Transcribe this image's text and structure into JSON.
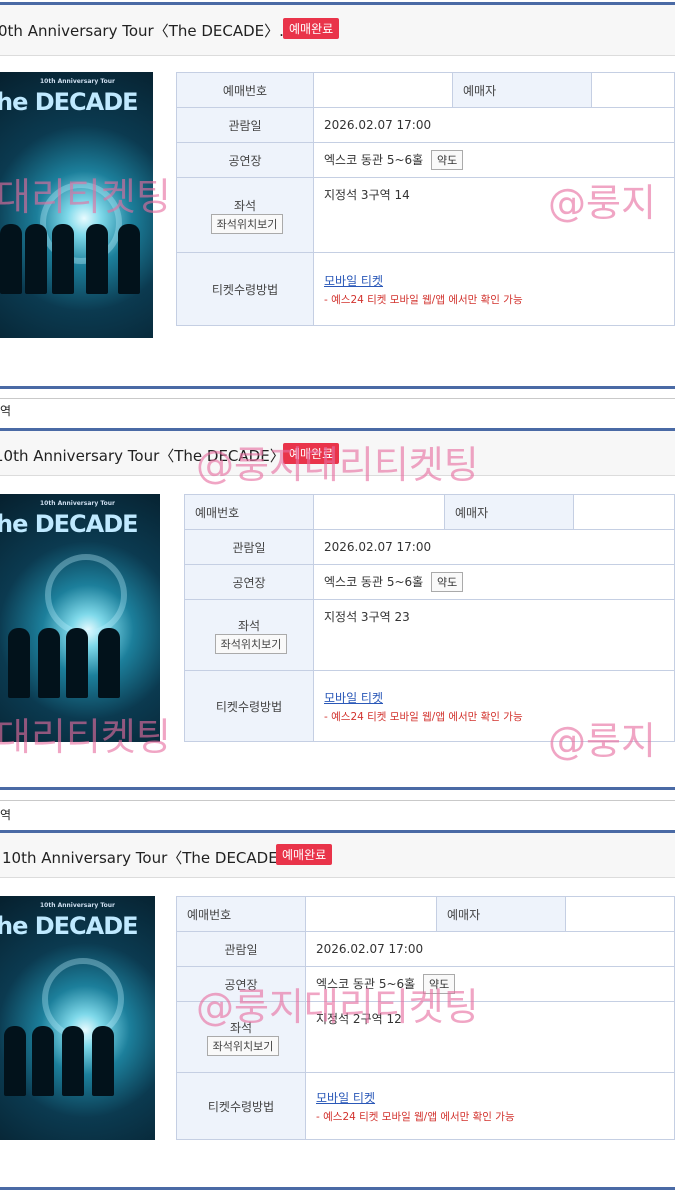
{
  "tickets": [
    {
      "title": "0th Anniversary Tour〈The DECADE〉..",
      "badge": "예매완료",
      "poster": {
        "tour_label": "10th Anniversary Tour",
        "name": "he DECADE"
      },
      "rows": {
        "booking_label": "예매번호",
        "booker_label": "예매자",
        "date_label": "관람일",
        "date_value": "2026.02.07 17:00",
        "venue_label": "공연장",
        "venue_value": "엑스코 동관 5~6홀",
        "map_button": "약도",
        "seat_label": "좌석",
        "seat_value": "지정석 3구역 14",
        "seat_button": "좌석위치보기",
        "receive_label": "티켓수령방법",
        "receive_value": "모바일 티켓",
        "receive_note": "- 예스24 티켓 모바일 웹/앱 에서만 확인 가능"
      }
    },
    {
      "section_label": "역",
      "title": "10th Anniversary Tour〈The DECADE〉..",
      "badge": "예매완료",
      "poster": {
        "tour_label": "10th Anniversary Tour",
        "name": "he DECADE"
      },
      "rows": {
        "booking_label": "예매번호",
        "booker_label": "예매자",
        "date_label": "관람일",
        "date_value": "2026.02.07 17:00",
        "venue_label": "공연장",
        "venue_value": "엑스코 동관 5~6홀",
        "map_button": "약도",
        "seat_label": "좌석",
        "seat_value": "지정석 3구역 23",
        "seat_button": "좌석위치보기",
        "receive_label": "티켓수령방법",
        "receive_value": "모바일 티켓",
        "receive_note": "- 예스24 티켓 모바일 웹/앱 에서만 확인 가능"
      }
    },
    {
      "section_label": "역",
      "title": "10th Anniversary Tour〈The DECADE〉..",
      "badge": "예매완료",
      "poster": {
        "tour_label": "10th Anniversary Tour",
        "name": "he DECADE"
      },
      "rows": {
        "booking_label": "예매번호",
        "booker_label": "예매자",
        "date_label": "관람일",
        "date_value": "2026.02.07 17:00",
        "venue_label": "공연장",
        "venue_value": "엑스코 동관 5~6홀",
        "map_button": "약도",
        "seat_label": "좌석",
        "seat_value": "지정석 2구역 12",
        "seat_button": "좌석위치보기",
        "receive_label": "티켓수령방법",
        "receive_value": "모바일 티켓",
        "receive_note": "- 예스24 티켓 모바일 웹/앱 에서만 확인 가능"
      }
    }
  ],
  "watermarks": {
    "full": "@룽지대리티켓팅",
    "left_part": "대리티켓팅",
    "right_part": "@룽지"
  },
  "colors": {
    "badge": "#e9344a",
    "accent_bar": "#4a6aa5",
    "note_red": "#d2322d",
    "link_blue": "#2a58b8",
    "watermark": "#e66ea0"
  }
}
